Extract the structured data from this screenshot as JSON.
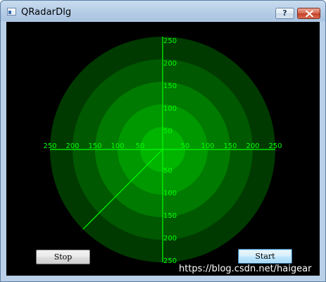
{
  "window": {
    "title": "QRadarDlg",
    "help_label": "?"
  },
  "radar": {
    "ring_values": [
      50,
      100,
      150,
      200,
      250
    ],
    "max_range": 250,
    "sweep_angle_deg": 225,
    "colors": {
      "background": "#000000",
      "rings": [
        "#00b400",
        "#009800",
        "#007a00",
        "#005800",
        "#003a00"
      ],
      "axis": "#00ff00",
      "label": "#00ff00",
      "sweep": "#00ff00"
    },
    "top_labels": [
      "250",
      "200",
      "150",
      "100",
      "50"
    ],
    "bottom_labels": [
      "50",
      "100",
      "150",
      "200",
      "250"
    ],
    "left_labels": [
      "250",
      "200",
      "150",
      "100",
      "50"
    ],
    "right_labels": [
      "50",
      "100",
      "150",
      "200",
      "250"
    ]
  },
  "buttons": {
    "stop_label": "Stop",
    "start_label": "Start"
  },
  "watermark": "https://blog.csdn.net/haigear"
}
